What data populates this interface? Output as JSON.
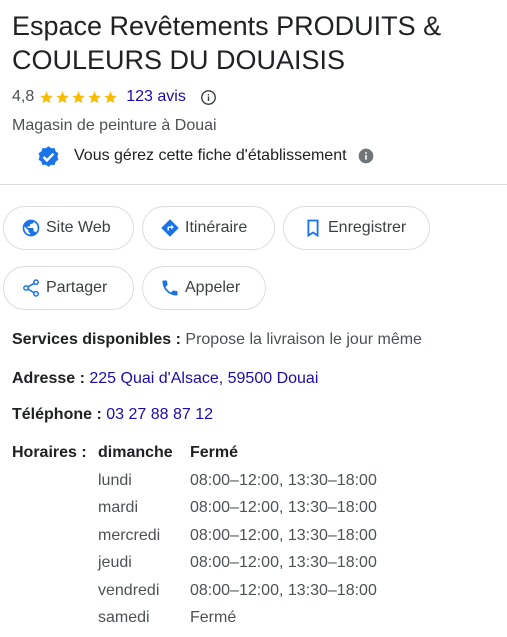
{
  "business": {
    "name": "Espace Revêtements PRODUITS & COULEURS DU DOUAISIS",
    "rating": "4,8",
    "stars": 5,
    "reviews": "123 avis",
    "category": "Magasin de peinture à Douai",
    "verified_text": "Vous gérez cette fiche d'établissement"
  },
  "actions": {
    "website": "Site Web",
    "directions": "Itinéraire",
    "save": "Enregistrer",
    "share": "Partager",
    "call": "Appeler"
  },
  "info": {
    "services_label": "Services disponibles :",
    "services_value": "Propose la livraison le jour même",
    "address_label": "Adresse :",
    "address_value": "225 Quai d'Alsace, 59500 Douai",
    "phone_label": "Téléphone :",
    "phone_value": "03 27 88 87 12",
    "hours_label": "Horaires :"
  },
  "hours": [
    {
      "day": "dimanche",
      "time": "Fermé"
    },
    {
      "day": "lundi",
      "time": "08:00–12:00, 13:30–18:00"
    },
    {
      "day": "mardi",
      "time": "08:00–12:00, 13:30–18:00"
    },
    {
      "day": "mercredi",
      "time": "08:00–12:00, 13:30–18:00"
    },
    {
      "day": "jeudi",
      "time": "08:00–12:00, 13:30–18:00"
    },
    {
      "day": "vendredi",
      "time": "08:00–12:00, 13:30–18:00"
    },
    {
      "day": "samedi",
      "time": "Fermé"
    }
  ],
  "colors": {
    "star": "#fbbc04",
    "link": "#1a0dab",
    "accent_blue": "#1a73e8",
    "verified_blue": "#1a73e8",
    "border": "#dadce0"
  },
  "icons": {
    "website": "globe-icon",
    "directions": "directions-icon",
    "save": "bookmark-icon",
    "share": "share-icon",
    "call": "phone-icon",
    "verified": "verified-badge-icon",
    "info": "info-icon"
  }
}
